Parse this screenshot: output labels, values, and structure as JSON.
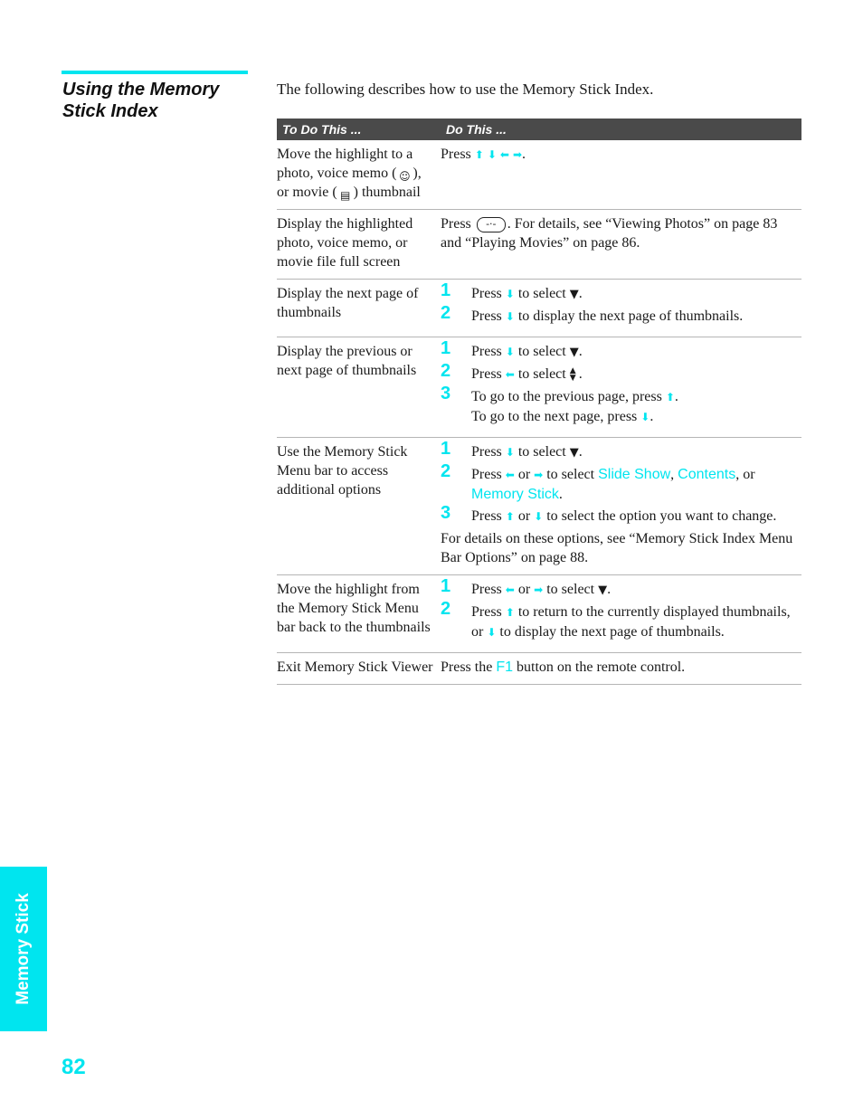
{
  "section": {
    "title": "Using the Memory Stick Index",
    "intro": "The following describes how to use the Memory Stick Index."
  },
  "table": {
    "headers": [
      "To Do This ...",
      "Do This ..."
    ],
    "rows": [
      {
        "task_parts": [
          "Move the highlight to a photo, voice memo (",
          "), or movie (",
          ") thumbnail"
        ],
        "press": "Press",
        "end": "."
      },
      {
        "task": "Display the highlighted photo, voice memo, or movie file full screen",
        "press": "Press",
        "rest": ". For details, see “Viewing Photos” on page 83 and “Playing Movies” on page 86."
      },
      {
        "task": "Display the next page of thumbnails",
        "steps": [
          {
            "num": "1",
            "a": "Press",
            "b": "to select",
            "c": "."
          },
          {
            "num": "2",
            "a": "Press",
            "b": "to display the next page of thumbnails."
          }
        ]
      },
      {
        "task": "Display the previous or next page of thumbnails",
        "steps": [
          {
            "num": "1",
            "a": "Press",
            "b": "to select",
            "c": "."
          },
          {
            "num": "2",
            "a": "Press",
            "b": "to select",
            "c": "."
          },
          {
            "num": "3",
            "a": "To go to the previous page, press",
            "c": ".",
            "d": "To go to the next page, press",
            "e": "."
          }
        ]
      },
      {
        "task": "Use the Memory Stick Menu bar to access additional options",
        "steps": [
          {
            "num": "1",
            "a": "Press",
            "b": "to select",
            "c": "."
          },
          {
            "num": "2",
            "a": "Press",
            "or": "or",
            "b": "to select",
            "link1": "Slide Show",
            "sep": ",",
            "link2": "Contents",
            "sep2": ", or",
            "link3": "Memory Stick",
            "c": "."
          },
          {
            "num": "3",
            "a": "Press",
            "or": "or",
            "b": "to select the option you want to change."
          }
        ],
        "note": "For details on these options, see “Memory Stick Index Menu Bar Options” on page 88."
      },
      {
        "task": "Move the highlight from the Memory Stick Menu bar back to the thumbnails",
        "steps": [
          {
            "num": "1",
            "a": "Press",
            "or": "or",
            "b": "to select",
            "c": "."
          },
          {
            "num": "2",
            "a": "Press",
            "b": "to return to the currently displayed thumbnails, or",
            "d": "to display the next page of thumbnails."
          }
        ]
      },
      {
        "task": "Exit Memory Stick Viewer",
        "a": "Press the",
        "key": "F1",
        "b": "button on the remote control."
      }
    ]
  },
  "icons": {
    "up": "⬆",
    "down": "⬇",
    "left": "⬅",
    "right": "➡",
    "tri_down": "▼",
    "tri_updown": "▲▼",
    "voice_memo": "☺",
    "movie": "▤",
    "enter": "-·-"
  },
  "side_tab": "Memory Stick",
  "page_number": "82",
  "colors": {
    "accent": "#00e5ef",
    "header_bg": "#4a4a4a"
  }
}
